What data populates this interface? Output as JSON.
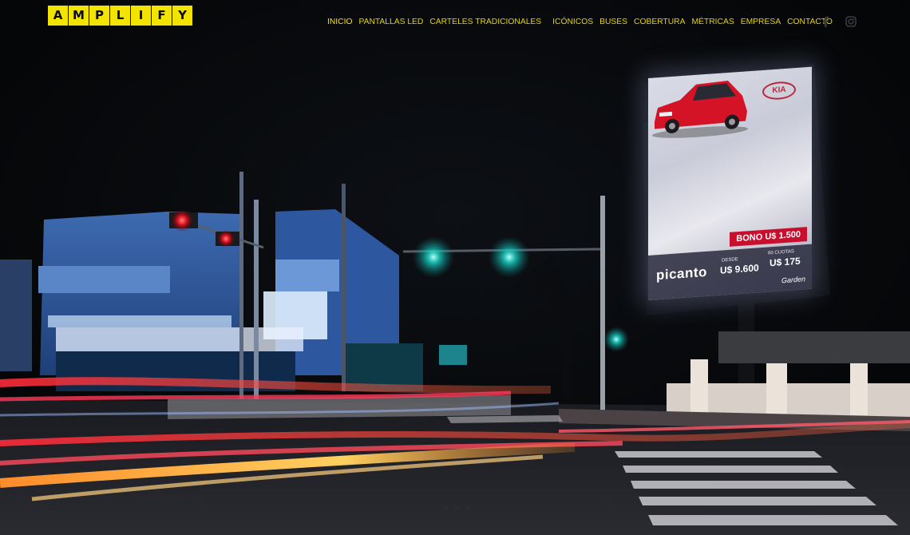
{
  "brand": {
    "letters": [
      "A",
      "M",
      "P",
      "L",
      "I",
      "F",
      "Y"
    ],
    "color": "#f2e400"
  },
  "nav": {
    "items": [
      {
        "label": "INICIO",
        "active": true
      },
      {
        "label": "PANTALLAS LED"
      },
      {
        "label": "CARTELES TRADICIONALES"
      },
      {
        "label": "ICÓNICOS"
      },
      {
        "label": "BUSES"
      },
      {
        "label": "COBERTURA"
      },
      {
        "label": "MÉTRICAS"
      },
      {
        "label": "EMPRESA"
      },
      {
        "label": "CONTACTO"
      }
    ],
    "color": "#e8d400"
  },
  "social": [
    "facebook-icon",
    "instagram-icon"
  ],
  "billboard": {
    "car_brand": "KIA",
    "bono": "BONO U$ 1.500",
    "model": "picanto",
    "desde_label": "DESDE",
    "desde_price": "U$ 9.600",
    "cuotas_label": "60 CUOTAS",
    "cuotas_price": "U$ 175",
    "dealer": "Garden"
  },
  "slider": {
    "dots": 3
  }
}
